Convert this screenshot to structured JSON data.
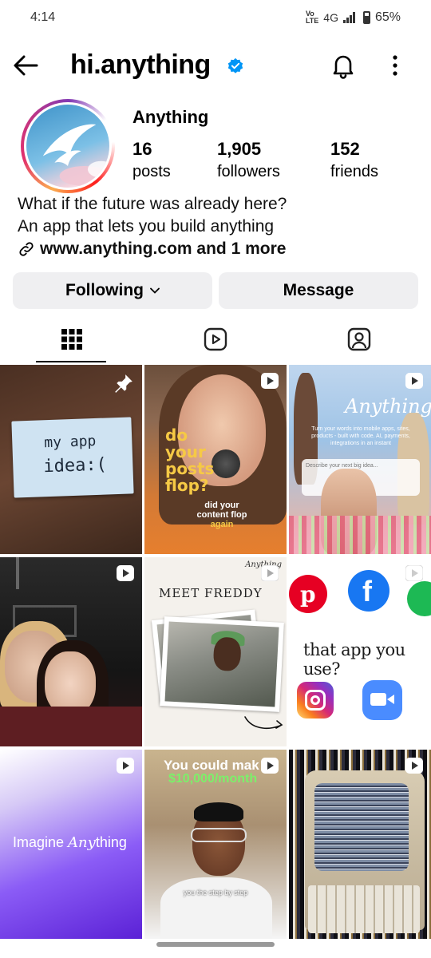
{
  "status_bar": {
    "time": "4:14",
    "network": "4G",
    "battery": "65%",
    "volte": "VoLTE"
  },
  "header": {
    "username": "hi.anything",
    "verified": true
  },
  "profile": {
    "display_name": "Anything",
    "stats": [
      {
        "value": "16",
        "label": "posts"
      },
      {
        "value": "1,905",
        "label": "followers"
      },
      {
        "value": "152",
        "label": "friends"
      }
    ],
    "bio_line1": "What if the future was already here?",
    "bio_line2": "An app that lets you build anything",
    "link_text": "www.anything.com and 1 more"
  },
  "buttons": {
    "following": "Following",
    "message": "Message"
  },
  "tabs": [
    {
      "name": "grid",
      "active": true
    },
    {
      "name": "reels",
      "active": false
    },
    {
      "name": "tagged",
      "active": false
    }
  ],
  "posts": {
    "p1": {
      "note_line1": "my app",
      "note_line2": "idea:("
    },
    "p2": {
      "hook": "do your posts flop?",
      "hook_l1": "do",
      "hook_l2": "your",
      "hook_l3": "posts",
      "hook_l4": "flop?",
      "caption_l1": "did your",
      "caption_l2": "content flop",
      "caption_l3": "again"
    },
    "p3": {
      "brand": "Anything",
      "sub": "Turn your words into mobile apps, sites, products - built with code. AI, payments, integrations in an instant",
      "placeholder": "Describe your next big idea..."
    },
    "p5": {
      "title": "MEET FREDDY",
      "logo": "Anything"
    },
    "p6": {
      "question": "that app you use?"
    },
    "p7": {
      "text_plain": "Imagine ",
      "text_italic": "Any",
      "text_rest": "thing"
    },
    "p8": {
      "line1": "You could mak",
      "line2": "$10,000/month",
      "subtitle": "you the step by step"
    }
  },
  "colors": {
    "verified_blue": "#0095f6",
    "accent_green": "#7cf06a"
  }
}
